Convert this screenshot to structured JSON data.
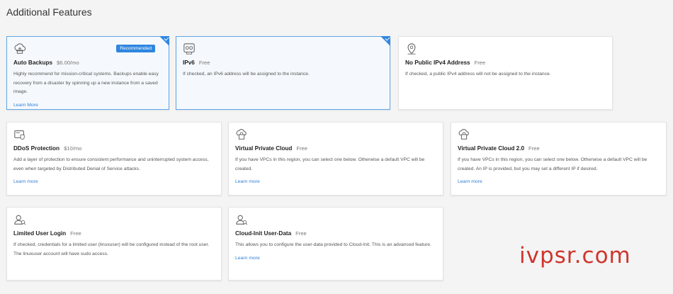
{
  "page_title": "Additional Features",
  "watermark": "ivpsr.com",
  "colors": {
    "accent": "#2f86df",
    "link": "#2f7ed8",
    "selected_border": "#5fa6e6",
    "watermark": "#d0342c"
  },
  "cards": [
    {
      "icon": "backup-icon",
      "name": "Auto Backups",
      "price": "$6.00/mo",
      "badge": "Recommended",
      "selected": true,
      "description": "Highly recommend for mission-critical systems. Backups enable easy recovery from a disaster by spinning up a new instance from a saved image.",
      "learn": "Learn More"
    },
    {
      "icon": "ipv6-icon",
      "name": "IPv6",
      "price": "Free",
      "selected": true,
      "description": "If checked, an IPv6 address will be assigned to the instance."
    },
    {
      "icon": "location-pin-icon",
      "name": "No Public IPv4 Address",
      "price": "Free",
      "selected": false,
      "description": "If checked, a public IPv4 address will not be assigned to the instance."
    },
    {
      "icon": "ddos-shield-icon",
      "name": "DDoS Protection",
      "price": "$10/mo",
      "selected": false,
      "description": "Add a layer of protection to ensure consistent performance and uninterrupted system access, even when targeted by Distributed Denial of Service attacks.",
      "learn": "Learn more"
    },
    {
      "icon": "vpc-icon",
      "name": "Virtual Private Cloud",
      "price": "Free",
      "selected": false,
      "description": "If you have VPCs in this region, you can select one below. Otherwise a default VPC will be created.",
      "learn": "Learn more"
    },
    {
      "icon": "vpc-icon",
      "name": "Virtual Private Cloud 2.0",
      "price": "Free",
      "selected": false,
      "description": "If you have VPCs in this region, you can select one below. Otherwise a default VPC will be created. An IP is provided, but you may set a different IP if desired.",
      "learn": "Learn more"
    },
    {
      "icon": "user-login-icon",
      "name": "Limited User Login",
      "price": "Free",
      "selected": false,
      "description": "If checked, credentials for a limited user (linuxuser) will be configured instead of the root user. The linuxuser account will have sudo access."
    },
    {
      "icon": "cloud-init-icon",
      "name": "Cloud-Init User-Data",
      "price": "Free",
      "selected": false,
      "description": "This allows you to configure the user-data provided to Cloud-Init. This is an advanced feature.",
      "learn": "Learn more"
    }
  ]
}
